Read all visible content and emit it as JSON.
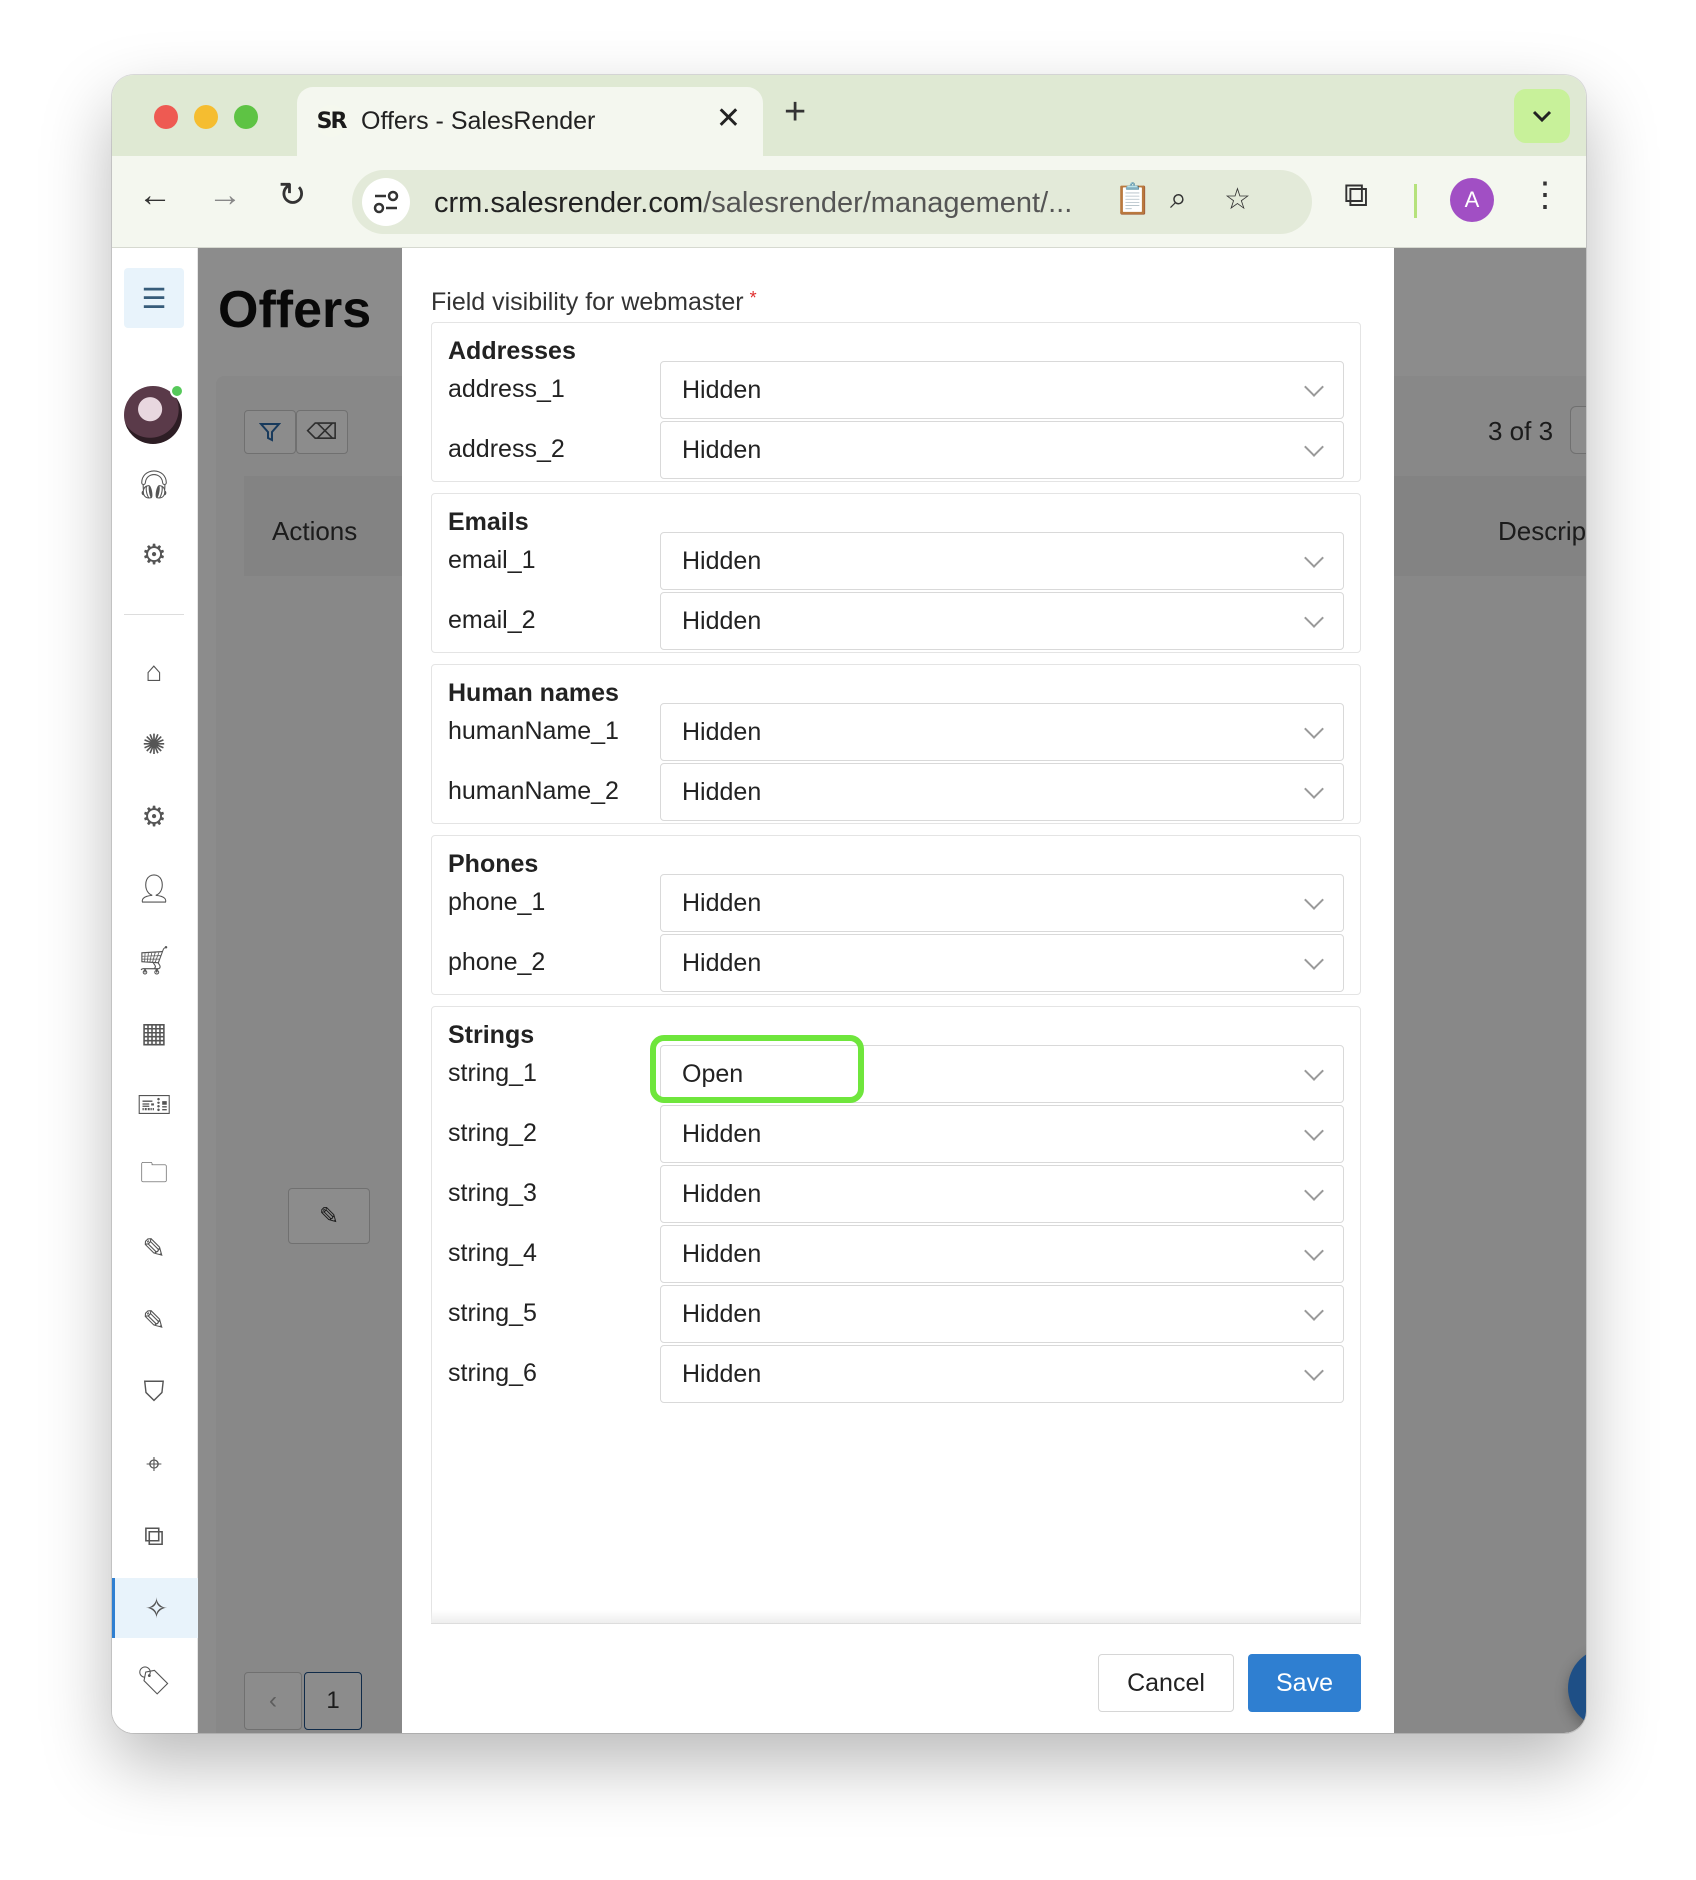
{
  "browser": {
    "tab_title": "Offers - SalesRender",
    "favicon_text": "SR",
    "url_host": "crm.salesrender.com",
    "url_path": "/salesrender/management/...",
    "profile_initial": "A"
  },
  "page": {
    "title": "Offers",
    "table": {
      "col_actions": "Actions",
      "col_description": "Description",
      "records": "3 of 3",
      "page_number": "1"
    }
  },
  "modal": {
    "label": "Field visibility for webmaster",
    "required_mark": "*",
    "groups": [
      {
        "title": "Addresses",
        "fields": [
          {
            "name": "address_1",
            "value": "Hidden"
          },
          {
            "name": "address_2",
            "value": "Hidden"
          }
        ]
      },
      {
        "title": "Emails",
        "fields": [
          {
            "name": "email_1",
            "value": "Hidden"
          },
          {
            "name": "email_2",
            "value": "Hidden"
          }
        ]
      },
      {
        "title": "Human names",
        "fields": [
          {
            "name": "humanName_1",
            "value": "Hidden"
          },
          {
            "name": "humanName_2",
            "value": "Hidden"
          }
        ]
      },
      {
        "title": "Phones",
        "fields": [
          {
            "name": "phone_1",
            "value": "Hidden"
          },
          {
            "name": "phone_2",
            "value": "Hidden"
          }
        ]
      },
      {
        "title": "Strings",
        "fields": [
          {
            "name": "string_1",
            "value": "Open"
          },
          {
            "name": "string_2",
            "value": "Hidden"
          },
          {
            "name": "string_3",
            "value": "Hidden"
          },
          {
            "name": "string_4",
            "value": "Hidden"
          },
          {
            "name": "string_5",
            "value": "Hidden"
          },
          {
            "name": "string_6",
            "value": "Hidden"
          }
        ]
      }
    ],
    "cancel_label": "Cancel",
    "save_label": "Save"
  },
  "colors": {
    "highlight": "#6fe63c",
    "primary": "#2f7fd1"
  }
}
